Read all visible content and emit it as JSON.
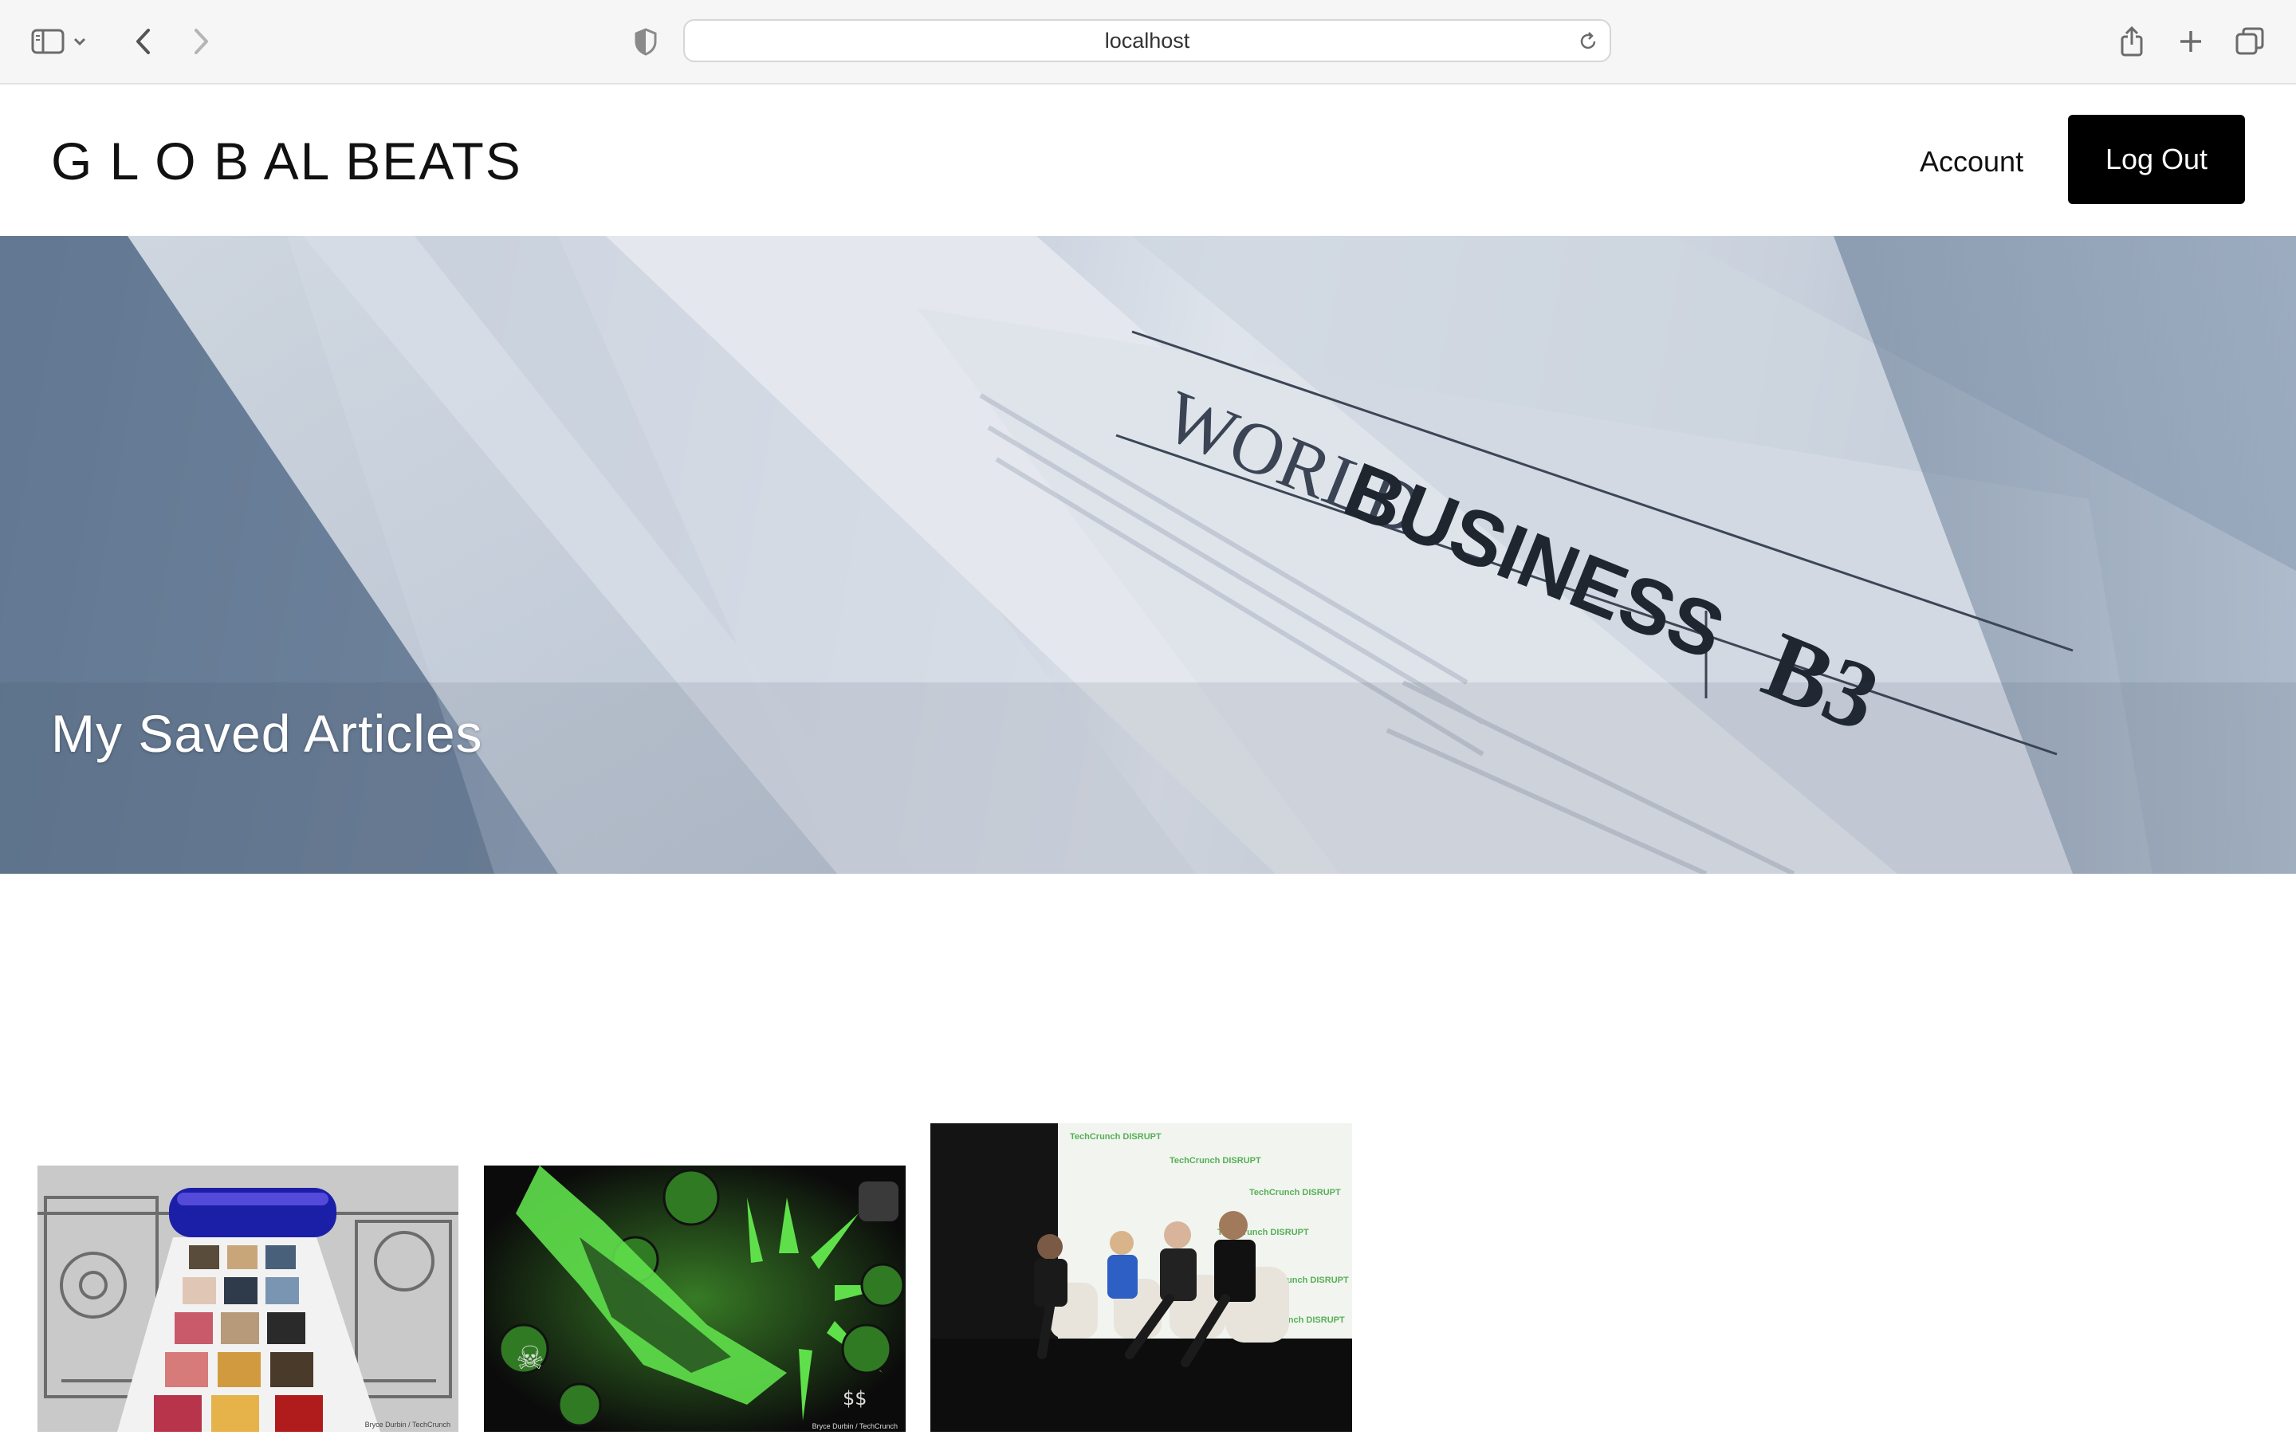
{
  "browser": {
    "url": "localhost",
    "icons": [
      "sidebar-icon",
      "chevron-down-icon",
      "back-arrow-icon",
      "forward-arrow-icon",
      "privacy-shield-icon",
      "reload-icon",
      "share-icon",
      "new-tab-plus-icon",
      "tabs-overview-icon"
    ]
  },
  "header": {
    "logo": "G L O B AL BEATS",
    "nav": {
      "account_label": "Account",
      "logout_label": "Log Out"
    }
  },
  "hero": {
    "title": "My Saved Articles",
    "image_words": [
      "WORLD",
      "BUSINESS",
      "B3"
    ]
  },
  "articles": {
    "cards": [
      {
        "image": "printing-press-roller-thumbnail",
        "credit": "Bryce Durbin / TechCrunch"
      },
      {
        "image": "green-emoji-sneaker-thumbnail",
        "credit": "Bryce Durbin / TechCrunch"
      },
      {
        "image": "techcrunch-disrupt-panel-thumbnail",
        "backdrop_text": "TechCrunch DISRUPT"
      }
    ]
  },
  "colors": {
    "logout_bg": "#000000",
    "logout_text": "#ffffff",
    "accent_green": "#5fe04b"
  }
}
